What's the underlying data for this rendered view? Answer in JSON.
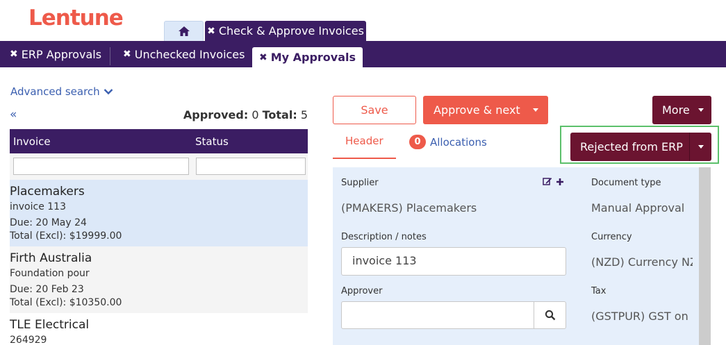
{
  "app": {
    "logo": "Lentune"
  },
  "top_tabs": {
    "home_icon": "home-icon",
    "check_approve": "Check & Approve Invoices"
  },
  "nav": {
    "erp": "ERP Approvals",
    "unchecked": "Unchecked Invoices",
    "my_approvals": "My Approvals"
  },
  "left": {
    "advanced_search": "Advanced search",
    "collapse": "«",
    "approved_label": "Approved:",
    "approved_value": "0",
    "total_label": "Total:",
    "total_value": "5",
    "columns": {
      "invoice": "Invoice",
      "status": "Status"
    },
    "items": [
      {
        "supplier": "Placemakers",
        "description": "invoice 113",
        "due": "Due: 20 May 24",
        "total": "Total (Excl): $19999.00"
      },
      {
        "supplier": "Firth Australia",
        "description": "Foundation pour",
        "due": "Due: 20 Feb 23",
        "total": "Total (Excl): $10350.00"
      },
      {
        "supplier": "TLE Electrical",
        "description": "264929"
      }
    ]
  },
  "right": {
    "save": "Save",
    "approve_next": "Approve & next",
    "more": "More",
    "rejected": "Rejected from ERP",
    "tabs": {
      "header": "Header",
      "allocations": "Allocations",
      "allocations_count": "0"
    },
    "form": {
      "supplier_label": "Supplier",
      "supplier_value": "(PMAKERS) Placemakers",
      "doc_type_label": "Document type",
      "doc_type_value": "Manual Approval",
      "desc_label": "Description / notes",
      "desc_value": "invoice 113",
      "currency_label": "Currency",
      "currency_value": "(NZD) Currency NZ",
      "approver_label": "Approver",
      "approver_value": "",
      "tax_label": "Tax",
      "tax_value": "(GSTPUR) GST on I"
    }
  }
}
